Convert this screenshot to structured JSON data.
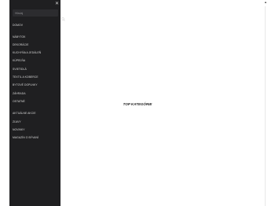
{
  "sidebar": {
    "close_glyph": "✕",
    "search": {
      "placeholder": "Hľadaj",
      "value": ""
    },
    "items": [
      {
        "label": "DOMOV"
      },
      {
        "label": "NÁBYTOK"
      },
      {
        "label": "DEKORÁCIE"
      },
      {
        "label": "KUCHYŇA A JEDÁLEŇ"
      },
      {
        "label": "KÚPEĽŇA"
      },
      {
        "label": "SVIETIDLÁ"
      },
      {
        "label": "TEXTIL A KOBERCE"
      },
      {
        "label": "BYTOVÉ DOPLNKY"
      },
      {
        "label": "ZÁHRADA"
      },
      {
        "label": "OSTATNÉ"
      },
      {
        "label": "AKTUÁLNE AKCIE"
      },
      {
        "label": "ZĽAVY"
      },
      {
        "label": "NOVINKY"
      },
      {
        "label": "MAGAZÍN O BÝVANÍ"
      }
    ]
  },
  "main": {
    "title": "TOP KATEGÓRIE"
  },
  "scroll": {
    "up_glyph": "▲"
  },
  "colors": {
    "sidebar_bg": "#1f1f21",
    "menu_text": "#d8d8d8",
    "page_bg": "#ffffff"
  }
}
